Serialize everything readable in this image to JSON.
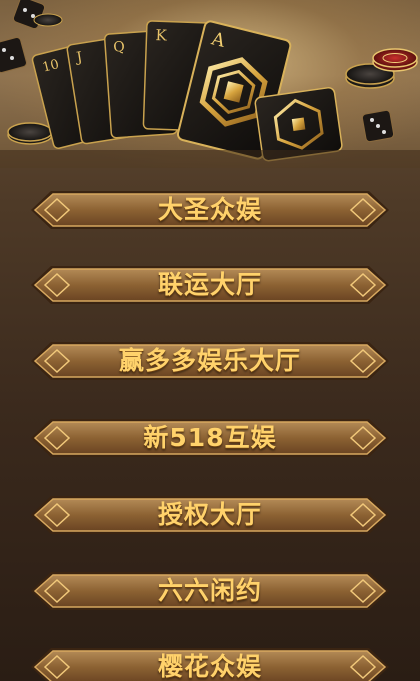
{
  "banner": {
    "cards": [
      {
        "rank": "10"
      },
      {
        "rank": "J"
      },
      {
        "rank": "Q"
      },
      {
        "rank": "K"
      },
      {
        "rank": "A"
      }
    ]
  },
  "menu": {
    "items": [
      {
        "label": "大圣众娱"
      },
      {
        "label": "联运大厅"
      },
      {
        "label": "赢多多娱乐大厅"
      },
      {
        "label": "新518互娱"
      },
      {
        "label": "授权大厅"
      },
      {
        "label": "六六闲约"
      },
      {
        "label": "樱花众娱"
      }
    ]
  },
  "colors": {
    "label_gold": "#ffd26b",
    "button_bronze": "#8c6233",
    "background_brown": "#3b2a1d"
  }
}
